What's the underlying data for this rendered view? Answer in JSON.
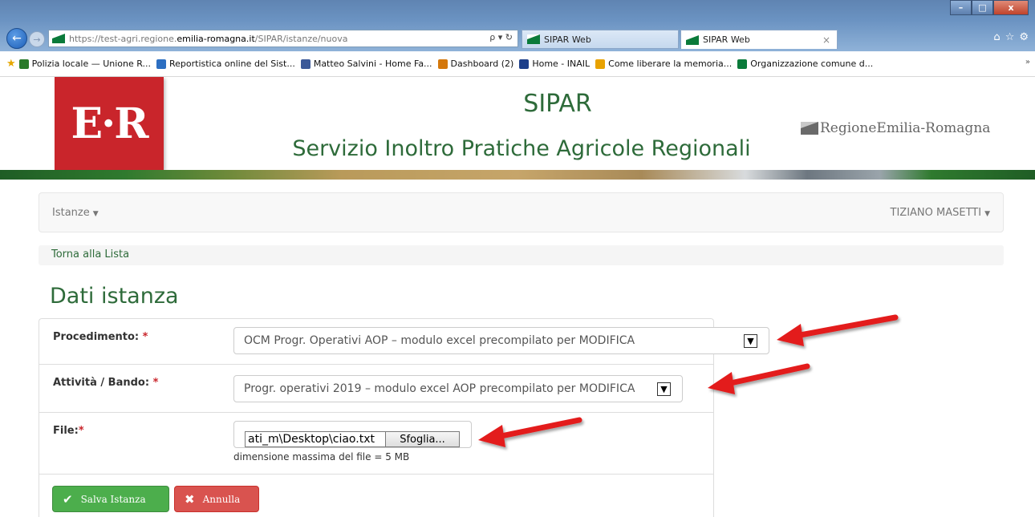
{
  "browser": {
    "url_prefix": "https://test-agri.regione.",
    "url_host": "emilia-romagna.it",
    "url_path": "/SIPAR/istanze/nuova",
    "addr_tools": "ρ ▾ ↻",
    "tabs": [
      {
        "label": "SIPAR Web"
      },
      {
        "label": "SIPAR Web",
        "close": "×"
      }
    ],
    "window_controls": {
      "minimize": "–",
      "maximize": "□",
      "close": "x"
    },
    "icons": [
      "home-icon",
      "star-icon",
      "gear-icon"
    ],
    "overflow": "»"
  },
  "bookmarks": [
    {
      "label": "Polizia locale — Unione R...",
      "color": "#2a7a2a"
    },
    {
      "label": "Reportistica online del Sist...",
      "color": "#2d6fc2"
    },
    {
      "label": "Matteo Salvini - Home Fa...",
      "color": "#3b5998"
    },
    {
      "label": "Dashboard (2)",
      "color": "#d4780c"
    },
    {
      "label": "Home - INAIL",
      "color": "#1d3f8a"
    },
    {
      "label": "Come liberare la memoria...",
      "color": "#e8a200"
    },
    {
      "label": "Organizzazione comune d...",
      "color": "#0a7a3a"
    }
  ],
  "banner": {
    "logo": "E·R",
    "title": "SIPAR",
    "subtitle": "Servizio Inoltro Pratiche Agricole Regionali",
    "region": "RegioneEmilia-Romagna"
  },
  "navbar": {
    "left": "Istanze",
    "right": "TIZIANO MASETTI"
  },
  "breadcrumb": "Torna alla Lista",
  "page_title": "Dati istanza",
  "form": {
    "procedimento": {
      "label": "Procedimento:",
      "required": "*",
      "value": "OCM Progr. Operativi AOP – modulo excel precompilato per MODIFICA"
    },
    "attivita": {
      "label": "Attività / Bando:",
      "required": "*",
      "value": "Progr. operativi 2019 – modulo excel AOP precompilato per MODIFICA"
    },
    "file": {
      "label": "File:",
      "required": "*",
      "value": "ati_m\\Desktop\\ciao.txt",
      "browse": "Sfoglia...",
      "hint": "dimensione massima del file = 5 MB"
    }
  },
  "buttons": {
    "save": "Salva Istanza",
    "cancel": "Annulla"
  },
  "colors": {
    "brand_green": "#2e6b3a",
    "logo_red": "#c9252b",
    "save_green": "#4cae4c",
    "cancel_red": "#d9534f",
    "annotation_red": "#e31b1b"
  }
}
